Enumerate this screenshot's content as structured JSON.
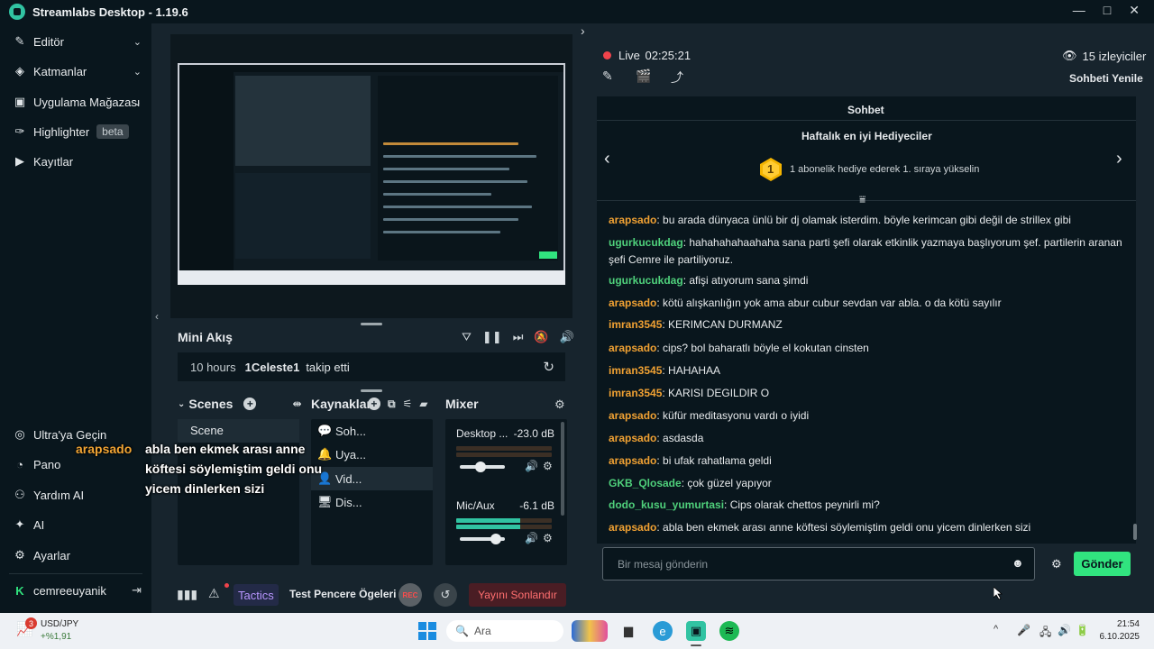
{
  "window": {
    "title": "Streamlabs Desktop - 1.19.6",
    "controls": [
      "—",
      "□",
      "✕"
    ]
  },
  "sidebar": {
    "top_items": [
      {
        "label": "Editör",
        "icon": "brush-icon"
      },
      {
        "label": "Katmanlar",
        "icon": "layers-icon"
      },
      {
        "label": "Uygulama Mağazası",
        "icon": "store-icon"
      },
      {
        "label": "Highlighter",
        "icon": "highlighter-icon",
        "badge": "beta"
      },
      {
        "label": "Kayıtlar",
        "icon": "recordings-icon"
      }
    ],
    "bottom_items": [
      {
        "label": "Ultra'ya Geçin",
        "icon": "ultra-icon"
      },
      {
        "label": "Pano",
        "icon": "dashboard-icon"
      },
      {
        "label": "Yardım AI",
        "icon": "help-ai-icon"
      },
      {
        "label": "AI",
        "icon": "sparkle-icon"
      },
      {
        "label": "Ayarlar",
        "icon": "gear-icon"
      }
    ],
    "user": {
      "name": "cemreeuyanik",
      "platform_icon": "kick-icon"
    }
  },
  "mini_feed": {
    "title": "Mini Akış",
    "event": {
      "time": "10 hours",
      "user": "1Celeste1",
      "action": "takip etti"
    }
  },
  "docks": {
    "scenes": {
      "title": "Scenes",
      "items": [
        "Scene"
      ]
    },
    "sources": {
      "title": "Kaynaklar",
      "items": [
        {
          "label": "Soh...",
          "icon": "chat-bubble-icon"
        },
        {
          "label": "Uya...",
          "icon": "alert-icon"
        },
        {
          "label": "Vid...",
          "icon": "webcam-icon"
        },
        {
          "label": "Dis...",
          "icon": "monitor-icon"
        }
      ]
    },
    "mixer": {
      "title": "Mixer",
      "channels": [
        {
          "name": "Desktop ...",
          "db": "-23.0 dB",
          "level": 0,
          "volume": 0.45
        },
        {
          "name": "Mic/Aux",
          "db": "-6.1 dB",
          "level": 0.67,
          "volume": 0.8
        }
      ]
    }
  },
  "footer": {
    "tactics": "Tactics",
    "test": "Test Pencere Ögeleri",
    "rec": "REC",
    "end": "Yayını Sonlandır"
  },
  "stream": {
    "status": "Live",
    "time": "02:25:21",
    "viewers": "15 izleyiciler",
    "refresh_chat": "Sohbeti Yenile"
  },
  "chat": {
    "title": "Sohbet",
    "top_gifters_title": "Haftalık en iyi Hediyeciler",
    "rank_number": "1",
    "rank_text": "1 abonelik hediye ederek 1. sıraya yükselin",
    "messages": [
      {
        "user": "arapsado",
        "color": "#f0a133",
        "text": ": bu arada dünyaca ünlü bir dj olamak isterdim. böyle kerimcan gibi değil de strillex gibi"
      },
      {
        "user": "ugurkucukdag",
        "color": "#4fd07b",
        "text": ": hahahahahaahaha sana parti şefi olarak etkinlik yazmaya başlıyorum şef. partilerin aranan şefi Cemre ile partiliyoruz."
      },
      {
        "user": "ugurkucukdag",
        "color": "#4fd07b",
        "text": ": afişi atıyorum sana şimdi"
      },
      {
        "user": "arapsado",
        "color": "#f0a133",
        "text": ": kötü alışkanlığın yok ama abur cubur sevdan var abla. o da kötü sayılır"
      },
      {
        "user": "imran3545",
        "color": "#f0a133",
        "text": ": KERIMCAN DURMANZ"
      },
      {
        "user": "arapsado",
        "color": "#f0a133",
        "text": ": cips? bol baharatlı böyle el kokutan cinsten"
      },
      {
        "user": "imran3545",
        "color": "#f0a133",
        "text": ": HAHAHAA"
      },
      {
        "user": "imran3545",
        "color": "#f0a133",
        "text": ": KARISI DEGILDIR O"
      },
      {
        "user": "arapsado",
        "color": "#f0a133",
        "text": ": küfür meditasyonu vardı o iyidi"
      },
      {
        "user": "arapsado",
        "color": "#f0a133",
        "text": ": asdasda"
      },
      {
        "user": "arapsado",
        "color": "#f0a133",
        "text": ": bi ufak rahatlama geldi"
      },
      {
        "user": "GKB_Qlosade",
        "color": "#4fd07b",
        "text": ": çok güzel yapıyor"
      },
      {
        "user": "dodo_kusu_yumurtasi",
        "color": "#4fd07b",
        "text": ": Cips olarak chettos peynirli mi?"
      },
      {
        "user": "arapsado",
        "color": "#f0a133",
        "text": ": abla ben ekmek arası anne köftesi söylemiştim geldi onu yicem dinlerken sizi"
      }
    ],
    "input_placeholder": "Bir mesaj gönderin",
    "send": "Gönder"
  },
  "overlay_alert": {
    "user": "arapsado",
    "lines": [
      "abla ben ekmek arası anne",
      "köftesi söylemiştim geldi onu",
      "yicem dinlerken sizi"
    ]
  },
  "taskbar": {
    "widget_badge": "3",
    "widget_title": "USD/JPY",
    "widget_value": "+%1,91",
    "search": "Ara",
    "time": "21:54",
    "date": "6.10.2025"
  },
  "colors": {
    "accent": "#31c3a2",
    "send": "#31e47f",
    "live": "#f0434b",
    "end_stream": "#ff6f6f"
  }
}
